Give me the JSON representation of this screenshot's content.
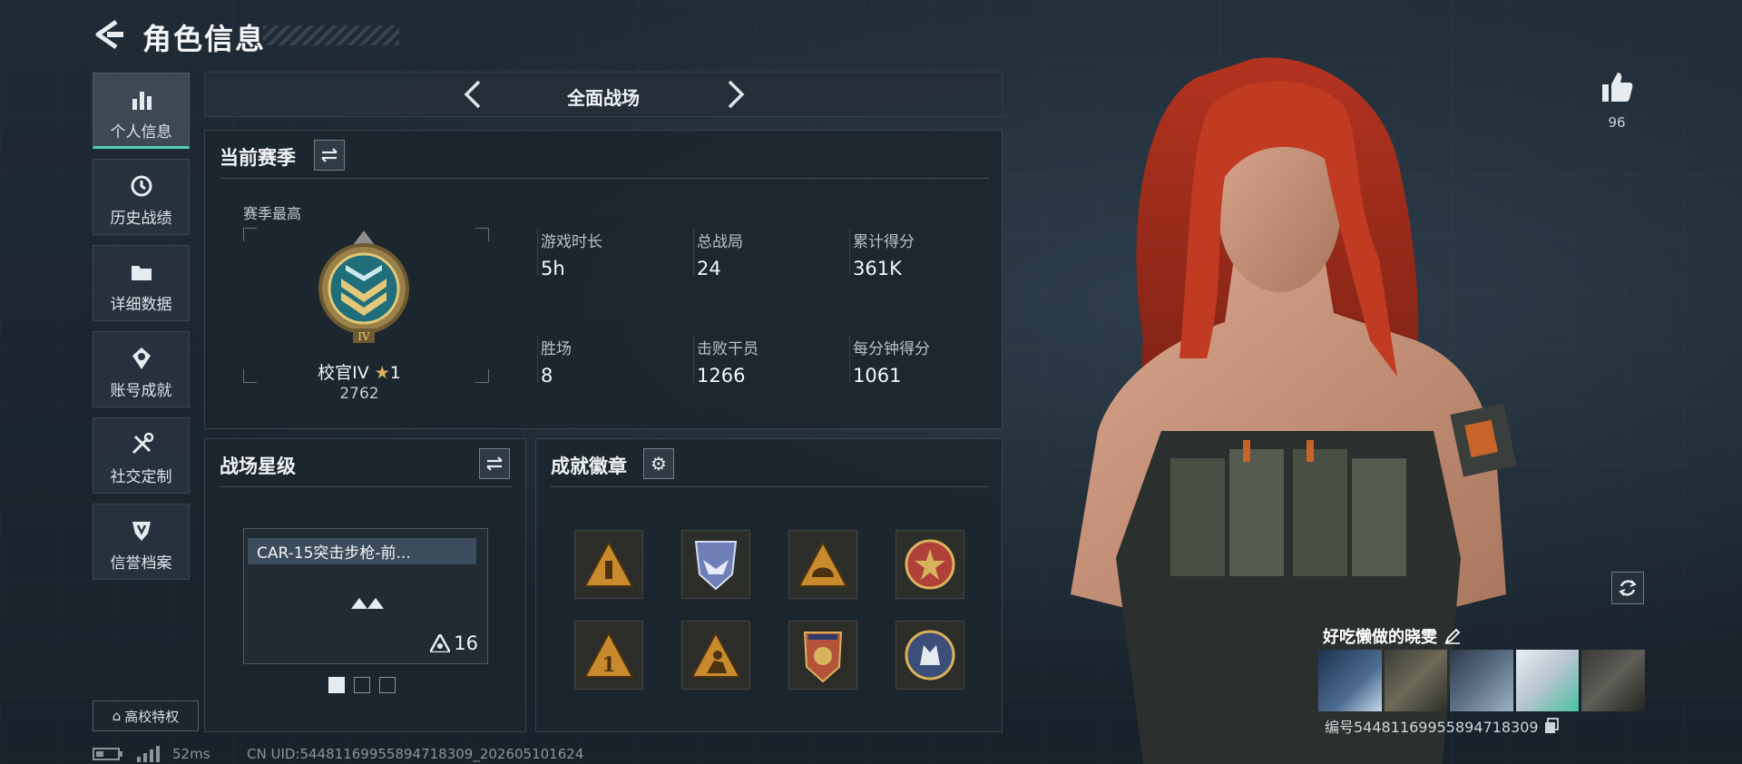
{
  "header": {
    "title": "角色信息"
  },
  "nav": [
    {
      "label": "个人信息",
      "icon": "bar-chart-icon",
      "active": true
    },
    {
      "label": "历史战绩",
      "icon": "history-clock-icon",
      "active": false
    },
    {
      "label": "详细数据",
      "icon": "folder-icon",
      "active": false
    },
    {
      "label": "账号成就",
      "icon": "achievement-icon",
      "active": false
    },
    {
      "label": "社交定制",
      "icon": "tools-icon",
      "active": false
    },
    {
      "label": "信誉档案",
      "icon": "shield-icon",
      "active": false
    }
  ],
  "campus_button": "高校特权",
  "status": {
    "ping": "52ms",
    "uid_line": "CN UID:5448116995589471830​9_202605101624"
  },
  "mode": {
    "label": "全面战场"
  },
  "season": {
    "title": "当前赛季",
    "best_label": "赛季最高",
    "rank_name": "校官IV",
    "rank_stars": "1",
    "rank_points": "2762",
    "stats": [
      {
        "label": "游戏时长",
        "value": "5h"
      },
      {
        "label": "总战局",
        "value": "24"
      },
      {
        "label": "累计得分",
        "value": "361K"
      },
      {
        "label": "胜场",
        "value": "8"
      },
      {
        "label": "击败干员",
        "value": "1266"
      },
      {
        "label": "每分钟得分",
        "value": "1061"
      }
    ]
  },
  "star_level": {
    "title": "战场星级",
    "weapon": "CAR-15突击步枪-前...",
    "level": "16",
    "pages": 3,
    "current_page": 1
  },
  "badges": {
    "title": "成就徽章",
    "items": [
      {
        "icon": "ammo-triangle-badge-icon",
        "color": "#c98a2e"
      },
      {
        "icon": "eagle-shield-badge-icon",
        "color": "#6f7fb8"
      },
      {
        "icon": "helmet-triangle-badge-icon",
        "color": "#c98a2e"
      },
      {
        "icon": "star-emblem-badge-icon",
        "color": "#b0413a"
      },
      {
        "icon": "number-one-triangle-badge-icon",
        "color": "#c98a2e"
      },
      {
        "icon": "soldier-triangle-badge-icon",
        "color": "#c98a2e"
      },
      {
        "icon": "star-shield-badge-icon",
        "color": "#b5533a"
      },
      {
        "icon": "wolf-circle-badge-icon",
        "color": "#3b4f7a"
      }
    ]
  },
  "player": {
    "likes": "96",
    "name": "好吃懒做的晓雯",
    "uid": "编号5448116995589471830​9"
  },
  "colors": {
    "accent": "#4fd1b6",
    "gold": "#d9b25c"
  }
}
